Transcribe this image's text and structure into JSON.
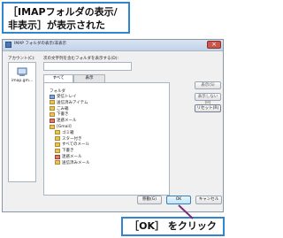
{
  "callout_top": {
    "line1": "［IMAPフォルダの表示/",
    "line2": "非表示］が表示された"
  },
  "dialog": {
    "title": "IMAP フォルダの表示/非表示",
    "close_label": "×",
    "account_label": "アカウント(C):",
    "account_name": "imap.gm...",
    "filter_label": "次の文字列を含むフォルダを表示する(D):",
    "tabs": [
      "すべて",
      "表示"
    ],
    "column_header": "フォルダ",
    "folders": [
      {
        "label": "受信トレイ",
        "indent": 1,
        "color": "blue"
      },
      {
        "label": "送信済みアイテム",
        "indent": 1,
        "color": "yellow"
      },
      {
        "label": "ごみ箱",
        "indent": 1,
        "color": "yellow"
      },
      {
        "label": "下書き",
        "indent": 1,
        "color": "yellow"
      },
      {
        "label": "迷惑メール",
        "indent": 1,
        "color": "red"
      },
      {
        "label": "[Gmail]",
        "indent": 1,
        "color": "yellow"
      },
      {
        "label": "ゴミ箱",
        "indent": 2,
        "color": "yellow"
      },
      {
        "label": "スター付き",
        "indent": 2,
        "color": "yellow"
      },
      {
        "label": "すべてのメール",
        "indent": 2,
        "color": "yellow"
      },
      {
        "label": "下書き",
        "indent": 2,
        "color": "yellow"
      },
      {
        "label": "迷惑メール",
        "indent": 2,
        "color": "red"
      },
      {
        "label": "送信済みメール",
        "indent": 2,
        "color": "yellow"
      }
    ],
    "side_buttons": [
      "表示(S)",
      "表示しない(H)",
      "リセット(R)"
    ],
    "bottom_buttons": {
      "move": "移動(G)",
      "ok": "OK",
      "cancel": "キャンセル"
    }
  },
  "callout_bottom": "［OK］ をクリック"
}
